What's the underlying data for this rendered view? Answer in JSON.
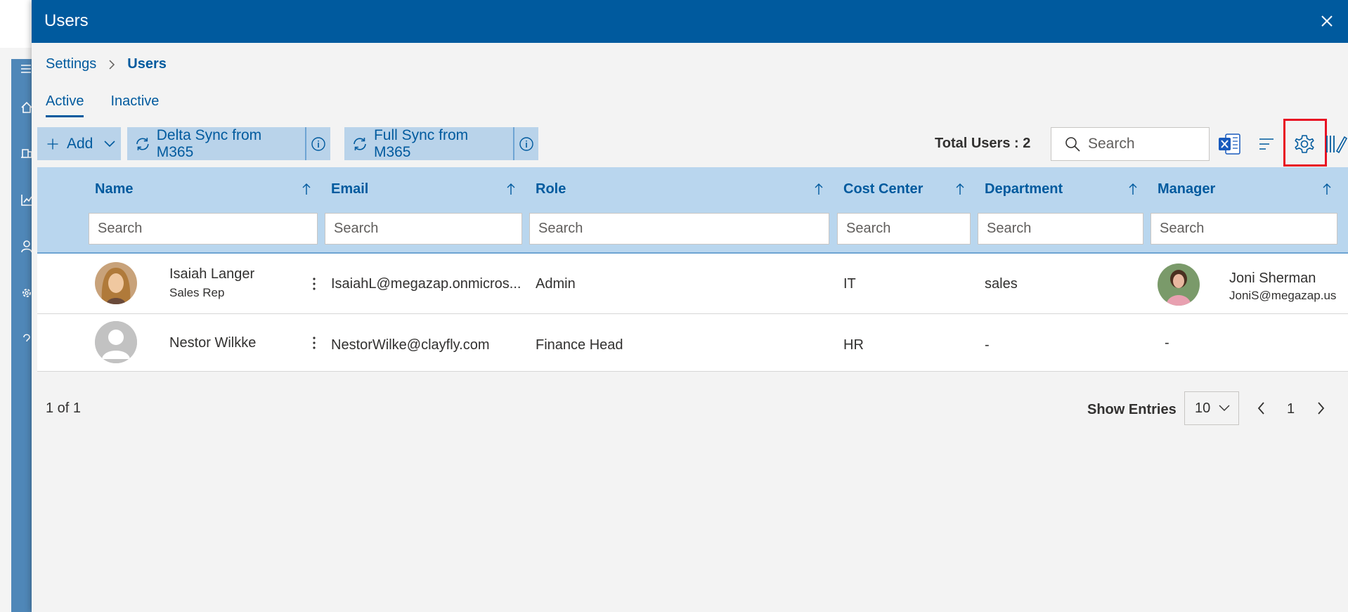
{
  "window": {
    "title": "Users"
  },
  "breadcrumb": {
    "root": "Settings",
    "current": "Users"
  },
  "tabs": [
    {
      "label": "Active",
      "active": true
    },
    {
      "label": "Inactive",
      "active": false
    }
  ],
  "toolbar": {
    "add_label": "Add",
    "delta_sync_label": "Delta Sync from M365",
    "full_sync_label": "Full Sync from M365",
    "total_users": "Total Users : 2",
    "search_placeholder": "Search",
    "icons": [
      "excel-export-icon",
      "sort-lines-icon",
      "gear-icon",
      "column-chooser-icon"
    ],
    "accent": "#005a9e",
    "highlight_color": "#e81123"
  },
  "grid": {
    "columns": [
      "Name",
      "Email",
      "Role",
      "Cost Center",
      "Department",
      "Manager"
    ],
    "filter_placeholder": "Search",
    "rows": [
      {
        "name": "Isaiah Langer",
        "title": "Sales Rep",
        "email": "IsaiahL@megazap.onmicros...",
        "role": "Admin",
        "cost_center": "IT",
        "department": "sales",
        "manager_name": "Joni Sherman",
        "manager_email": "JoniS@megazap.us"
      },
      {
        "name": "Nestor Wilkke",
        "title": "",
        "email": "NestorWilke@clayfly.com",
        "role": "Finance Head",
        "cost_center": "HR",
        "department": "-",
        "manager_name": "-",
        "manager_email": ""
      }
    ]
  },
  "footer": {
    "page_count": "1 of 1",
    "show_entries_label": "Show Entries",
    "entries_value": "10",
    "current_page": "1"
  }
}
